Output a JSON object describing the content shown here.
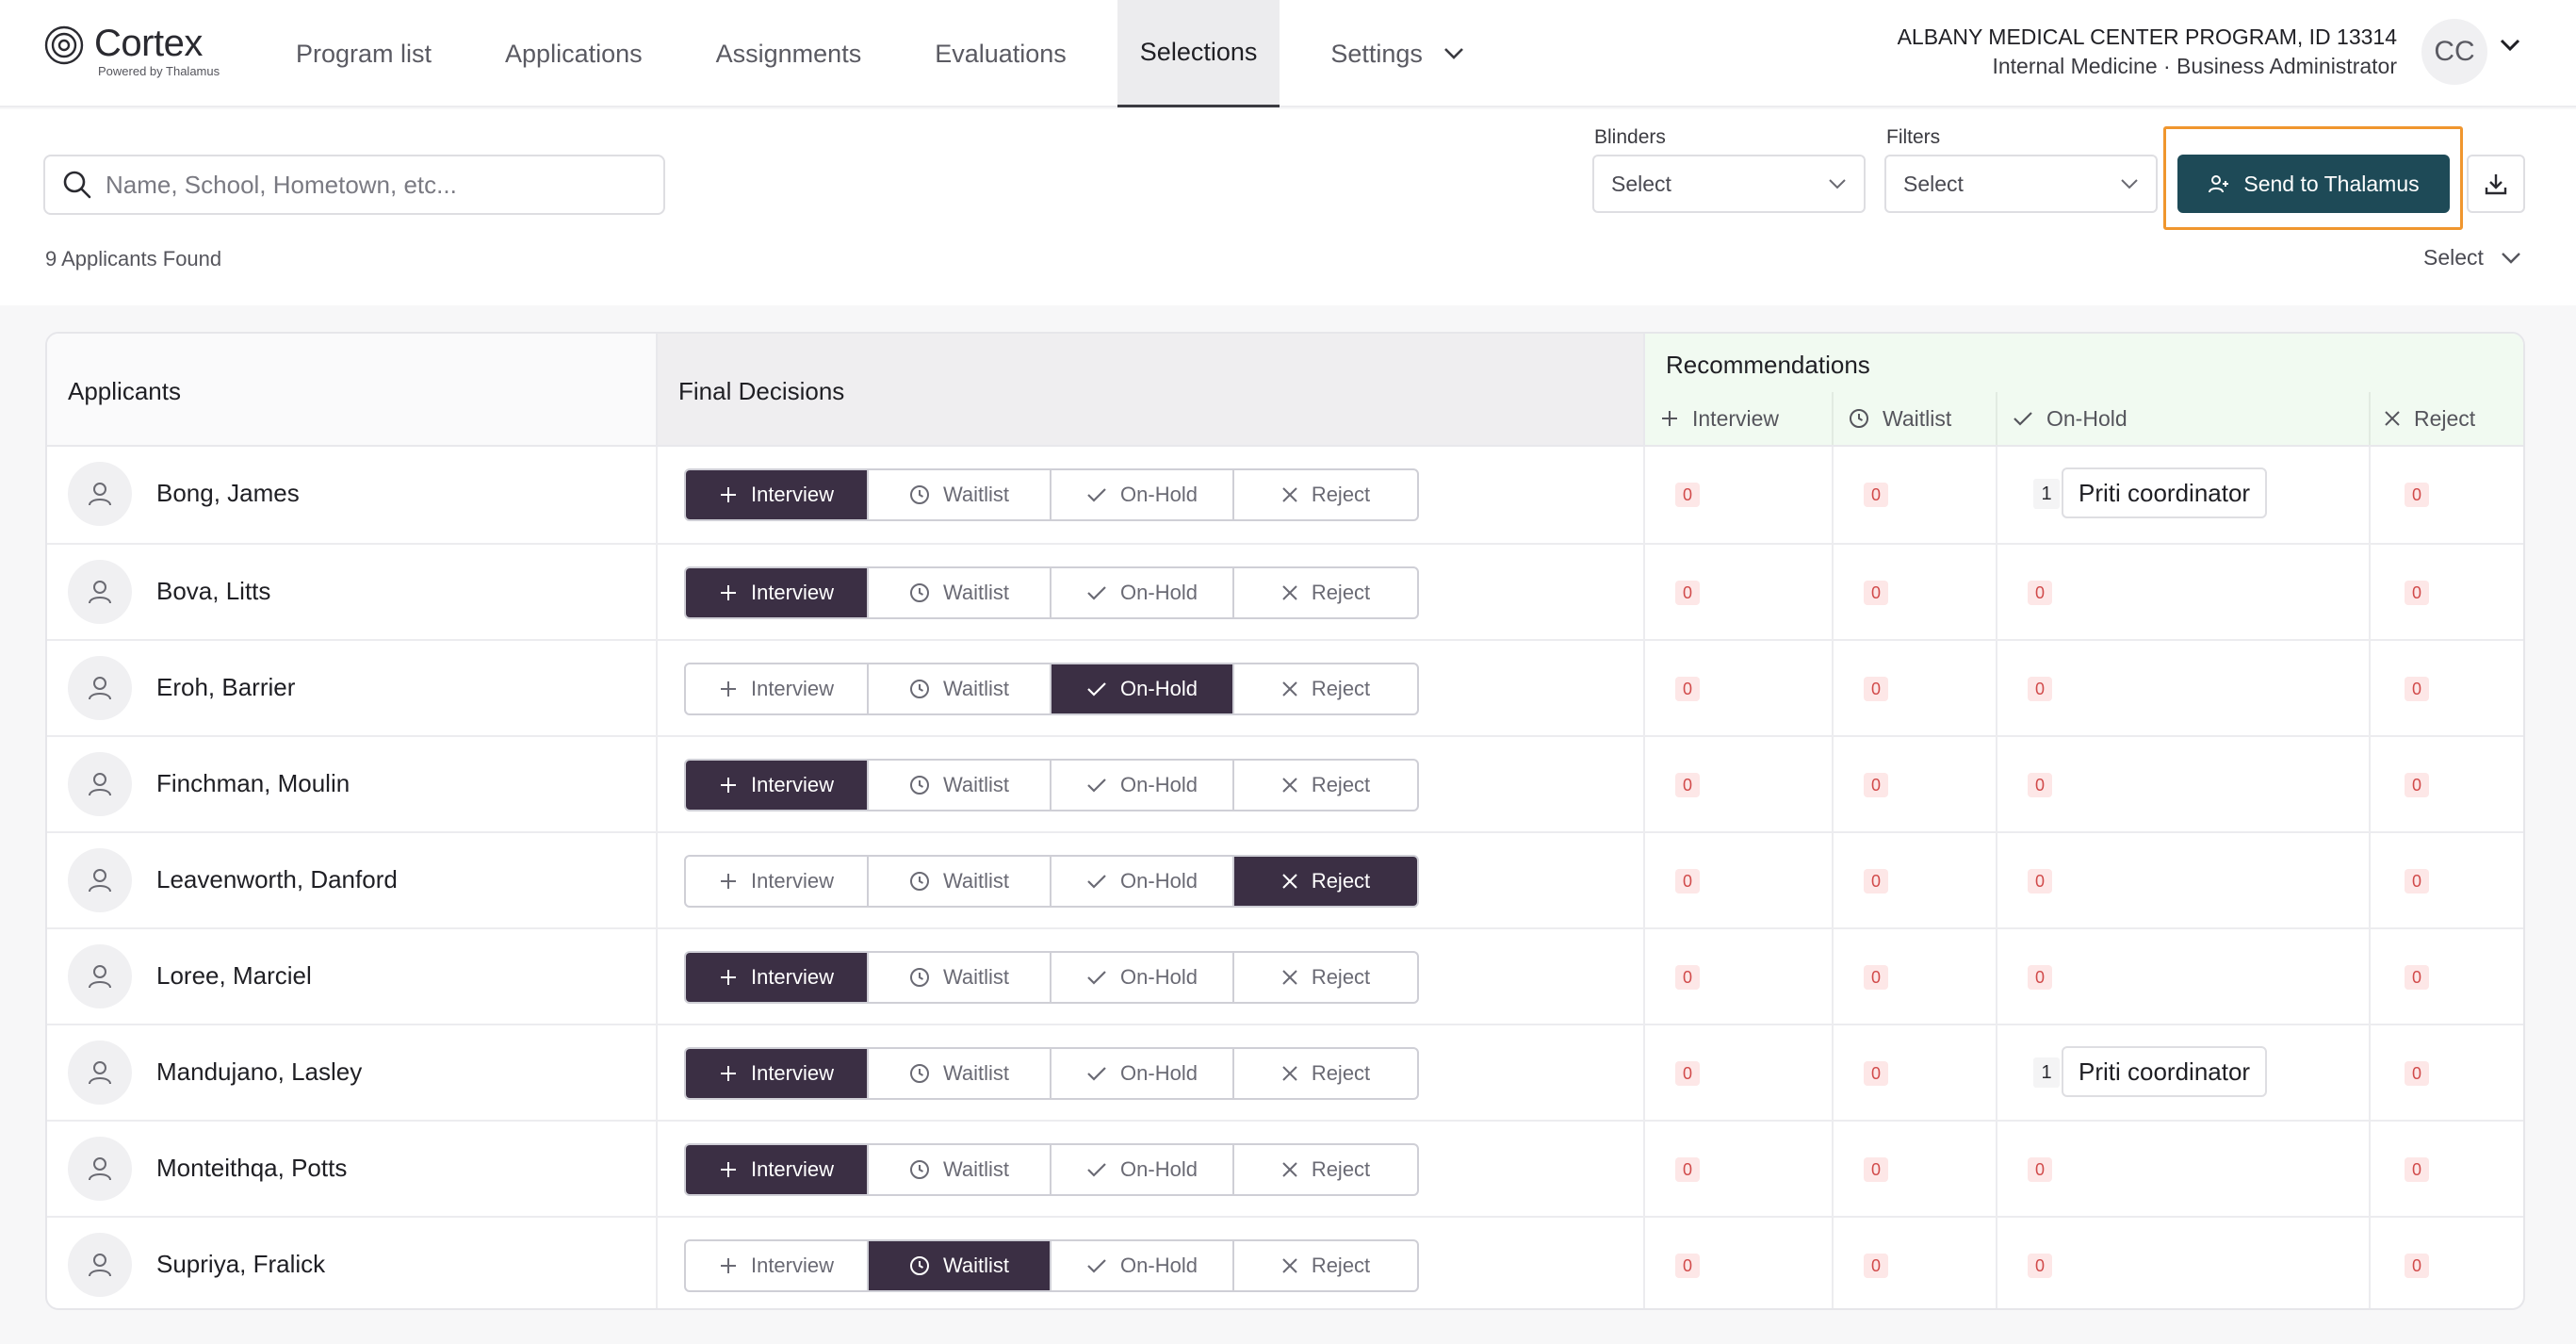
{
  "brand": {
    "name": "Cortex",
    "tagline": "Powered by Thalamus"
  },
  "nav": {
    "items": [
      {
        "label": "Program list"
      },
      {
        "label": "Applications"
      },
      {
        "label": "Assignments"
      },
      {
        "label": "Evaluations"
      },
      {
        "label": "Selections",
        "active": true
      },
      {
        "label": "Settings"
      }
    ]
  },
  "account": {
    "program": "ALBANY MEDICAL CENTER PROGRAM, ID 13314",
    "role": "Internal Medicine · Business Administrator",
    "initials": "CC"
  },
  "search": {
    "placeholder": "Name, School, Hometown, etc..."
  },
  "blinders": {
    "label": "Blinders",
    "value": "Select"
  },
  "filters": {
    "label": "Filters",
    "value": "Select"
  },
  "actions": {
    "send_label": "Send to Thalamus"
  },
  "results": {
    "count_text": "9 Applicants Found",
    "sort_value": "Select"
  },
  "table": {
    "headers": {
      "applicants": "Applicants",
      "final_decisions": "Final Decisions",
      "recommendations": "Recommendations",
      "rec_columns": [
        "Interview",
        "Waitlist",
        "On-Hold",
        "Reject"
      ]
    },
    "decision_options": [
      "Interview",
      "Waitlist",
      "On-Hold",
      "Reject"
    ],
    "rows": [
      {
        "name": "Bong, James",
        "decision": "Interview",
        "rec": [
          "0",
          "0",
          "1",
          "0"
        ],
        "onhold_chip": "Priti coordinator"
      },
      {
        "name": "Bova, Litts",
        "decision": "Interview",
        "rec": [
          "0",
          "0",
          "0",
          "0"
        ]
      },
      {
        "name": "Eroh, Barrier",
        "decision": "On-Hold",
        "rec": [
          "0",
          "0",
          "0",
          "0"
        ]
      },
      {
        "name": "Finchman, Moulin",
        "decision": "Interview",
        "rec": [
          "0",
          "0",
          "0",
          "0"
        ]
      },
      {
        "name": "Leavenworth, Danford",
        "decision": "Reject",
        "rec": [
          "0",
          "0",
          "0",
          "0"
        ]
      },
      {
        "name": "Loree, Marciel",
        "decision": "Interview",
        "rec": [
          "0",
          "0",
          "0",
          "0"
        ]
      },
      {
        "name": "Mandujano, Lasley",
        "decision": "Interview",
        "rec": [
          "0",
          "0",
          "1",
          "0"
        ],
        "onhold_chip": "Priti coordinator"
      },
      {
        "name": "Monteithqa, Potts",
        "decision": "Interview",
        "rec": [
          "0",
          "0",
          "0",
          "0"
        ]
      },
      {
        "name": "Supriya, Fralick",
        "decision": "Waitlist",
        "rec": [
          "0",
          "0",
          "0",
          "0"
        ]
      }
    ]
  },
  "colors": {
    "accent_button": "#1e4a57",
    "selected_segment": "#3b2f44",
    "highlight_outline": "#f0962e",
    "zero_badge_bg": "#fde7e7",
    "zero_badge_text": "#d14a4a",
    "recommendations_bg": "#f1faf1"
  }
}
